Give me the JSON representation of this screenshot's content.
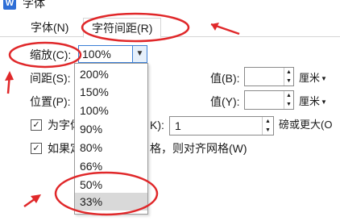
{
  "window": {
    "title": "字体",
    "app_icon_glyph": "W"
  },
  "tabs": [
    {
      "label": "字体(N)"
    },
    {
      "label": "字符间距(R)"
    }
  ],
  "scale": {
    "label": "缩放(C):",
    "value": "100%",
    "options": [
      "200%",
      "150%",
      "100%",
      "90%",
      "80%",
      "66%",
      "50%",
      "33%"
    ],
    "highlighted": "33%"
  },
  "spacing": {
    "label": "间距(S):",
    "value_label": "值(B):",
    "value": "",
    "unit": "厘米"
  },
  "position": {
    "label": "位置(P):",
    "value_label": "值(Y):",
    "value": "",
    "unit": "厘米"
  },
  "kerning": {
    "label_partial": "为字体",
    "label_suffix": "K):",
    "value": "1",
    "suffix": "磅或更大(O"
  },
  "grid": {
    "label_partial": "如果定",
    "label_suffix": "格，则对齐网格(W)"
  },
  "annotation_color": "#e0282a"
}
